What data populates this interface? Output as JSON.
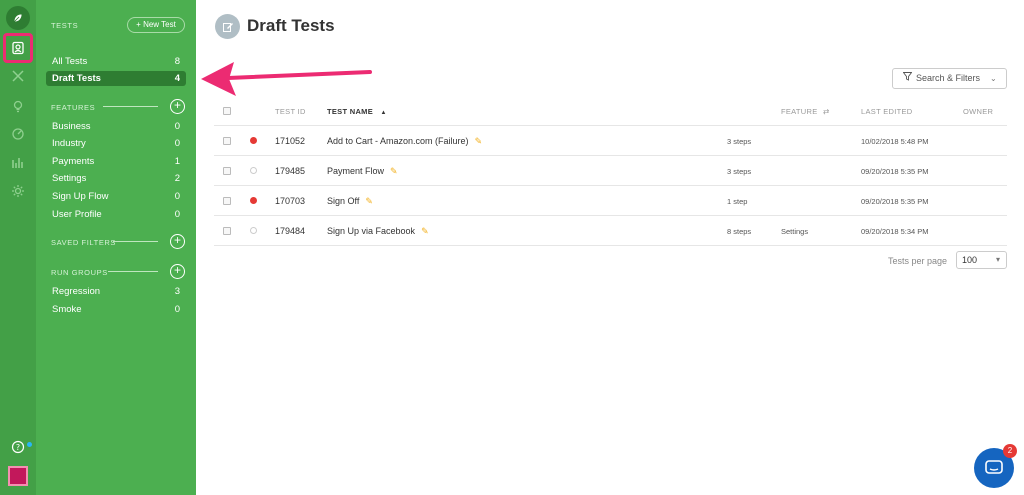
{
  "sidebar": {
    "tests_heading": "TESTS",
    "new_test_label": "+ New Test",
    "nav": [
      {
        "label": "All Tests",
        "count": "8"
      },
      {
        "label": "Draft Tests",
        "count": "4"
      }
    ],
    "features_heading": "FEATURES",
    "features": [
      {
        "label": "Business",
        "count": "0"
      },
      {
        "label": "Industry",
        "count": "0"
      },
      {
        "label": "Payments",
        "count": "1"
      },
      {
        "label": "Settings",
        "count": "2"
      },
      {
        "label": "Sign Up Flow",
        "count": "0"
      },
      {
        "label": "User Profile",
        "count": "0"
      }
    ],
    "saved_filters_heading": "SAVED FILTERS",
    "run_groups_heading": "RUN GROUPS",
    "run_groups": [
      {
        "label": "Regression",
        "count": "3"
      },
      {
        "label": "Smoke",
        "count": "0"
      }
    ]
  },
  "main": {
    "title": "Draft Tests",
    "search_filters_label": "Search & Filters",
    "columns": {
      "test_id": "TEST ID",
      "test_name": "TEST NAME",
      "sort_indicator": "▲",
      "feature": "FEATURE",
      "feature_icon": "⇄",
      "last_edited": "LAST EDITED",
      "owner": "OWNER"
    },
    "rows": [
      {
        "id": "171052",
        "name": "Add to Cart - Amazon.com (Failure)",
        "status": "failed",
        "steps": "3 steps",
        "feature": "",
        "edited": "10/02/2018 5:48 PM"
      },
      {
        "id": "179485",
        "name": "Payment Flow",
        "status": "none",
        "steps": "3 steps",
        "feature": "",
        "edited": "09/20/2018 5:35 PM"
      },
      {
        "id": "170703",
        "name": "Sign Off",
        "status": "failed",
        "steps": "1 step",
        "feature": "",
        "edited": "09/20/2018 5:35 PM"
      },
      {
        "id": "179484",
        "name": "Sign Up via Facebook",
        "status": "none",
        "steps": "8 steps",
        "feature": "Settings",
        "edited": "09/20/2018 5:34 PM"
      }
    ],
    "per_page_label": "Tests per page",
    "per_page_value": "100"
  },
  "chat": {
    "badge": "2"
  },
  "colors": {
    "rail": "#43a047",
    "panel": "#4caf50",
    "active_item": "#2e7d32",
    "highlight": "#ec2b72",
    "failed": "#e53935",
    "edit_icon": "#f2b01e"
  },
  "icons": [
    "leaf-logo-icon",
    "tests-icon",
    "tools-icon",
    "bulb-icon",
    "dashboard-icon",
    "chart-icon",
    "gear-icon",
    "help-icon",
    "avatar",
    "edit-icon",
    "filter-icon",
    "chat-icon"
  ]
}
